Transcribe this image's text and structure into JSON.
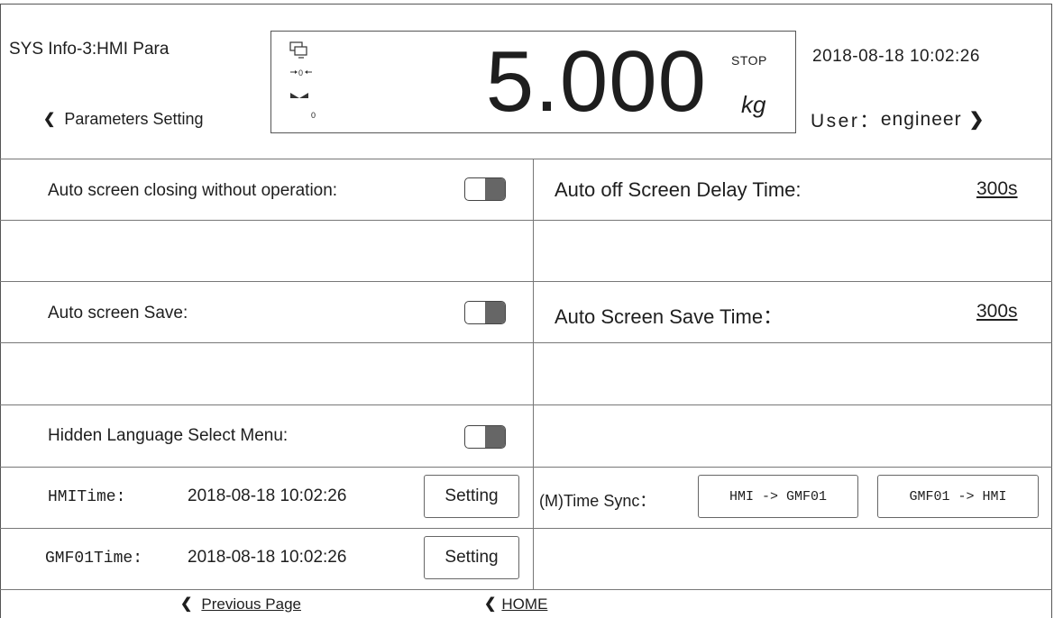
{
  "header": {
    "title": "SYS Info-3:HMI Para",
    "back_label": "Parameters Setting",
    "datetime": "2018-08-18 10:02:26",
    "user_prefix": "User：",
    "user_name": "engineer"
  },
  "weighing": {
    "value": "5.000",
    "status": "STOP",
    "unit": "kg",
    "zero_marker": "0",
    "icons": [
      "monitor-icon",
      "zero-center-icon",
      "stable-icon"
    ]
  },
  "settings": {
    "auto_screen_closing": {
      "label": "Auto screen closing without operation:",
      "enabled": false
    },
    "auto_off_delay": {
      "label": "Auto off Screen Delay Time:",
      "value": "300s"
    },
    "auto_screen_save": {
      "label": "Auto screen Save:",
      "enabled": false
    },
    "auto_screen_save_time": {
      "label": "Auto Screen Save Time：",
      "value": "300s"
    },
    "hidden_language_menu": {
      "label": "Hidden Language Select Menu:",
      "enabled": false
    },
    "hmi_time": {
      "label": "HMITime:",
      "value": "2018-08-18 10:02:26",
      "button": "Setting"
    },
    "gmf01_time": {
      "label": "GMF01Time:",
      "value": "2018-08-18 10:02:26",
      "button": "Setting"
    },
    "time_sync": {
      "label": "(M)Time Sync：",
      "hmi_to_gmf": "HMI -> GMF01",
      "gmf_to_hmi": "GMF01 -> HMI"
    }
  },
  "footer": {
    "previous_page": "Previous Page",
    "home": "HOME"
  }
}
